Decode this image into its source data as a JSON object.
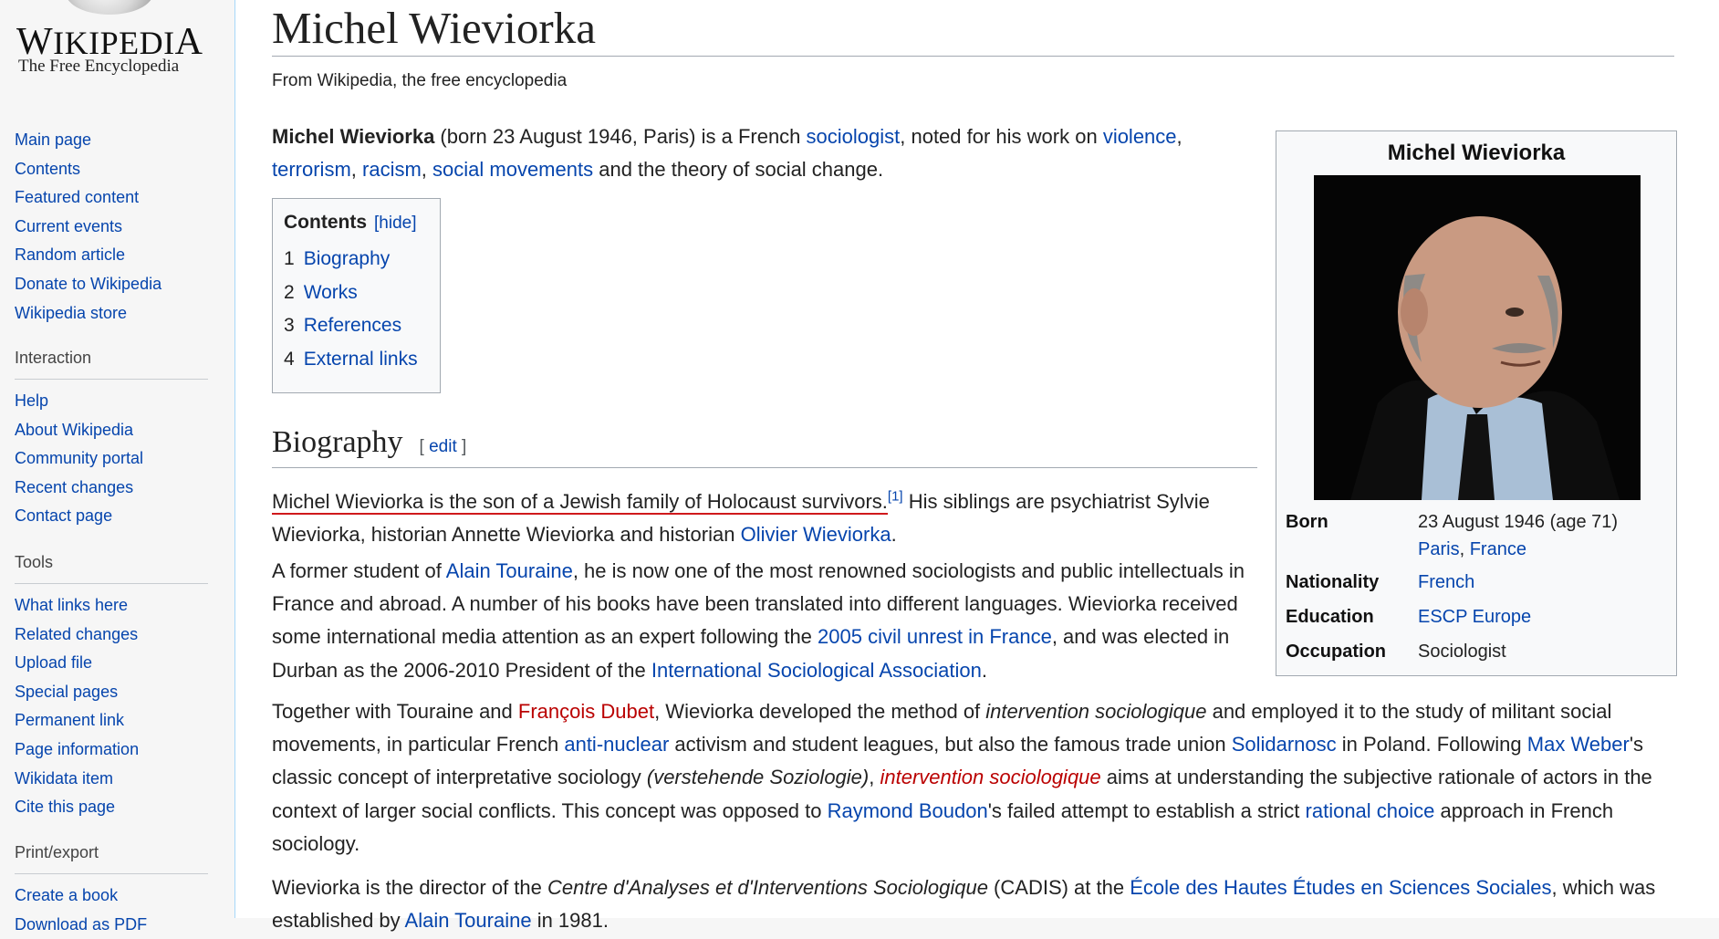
{
  "logo": {
    "wordmark": "Wikipedia",
    "tagline": "The Free Encyclopedia"
  },
  "sidebar": {
    "navigation": [
      "Main page",
      "Contents",
      "Featured content",
      "Current events",
      "Random article",
      "Donate to Wikipedia",
      "Wikipedia store"
    ],
    "interaction": {
      "heading": "Interaction",
      "items": [
        "Help",
        "About Wikipedia",
        "Community portal",
        "Recent changes",
        "Contact page"
      ]
    },
    "tools": {
      "heading": "Tools",
      "items": [
        "What links here",
        "Related changes",
        "Upload file",
        "Special pages",
        "Permanent link",
        "Page information",
        "Wikidata item",
        "Cite this page"
      ]
    },
    "print": {
      "heading": "Print/export",
      "items": [
        "Create a book",
        "Download as PDF"
      ]
    }
  },
  "article": {
    "title": "Michel Wieviorka",
    "site_sub": "From Wikipedia, the free encyclopedia",
    "lead": {
      "bold_name": "Michel Wieviorka",
      "t1": " (born 23 August 1946, Paris) is a French ",
      "link_sociologist": "sociologist",
      "t2": ", noted for his work on ",
      "link_violence": "violence",
      "t3": ", ",
      "link_terrorism": "terrorism",
      "t4": ", ",
      "link_racism": "racism",
      "t5": ", ",
      "link_social_movements": "social movements",
      "t6": " and the theory of social change."
    },
    "toc": {
      "title": "Contents",
      "toggle": "[hide]",
      "items": [
        {
          "num": "1",
          "label": "Biography"
        },
        {
          "num": "2",
          "label": "Works"
        },
        {
          "num": "3",
          "label": "References"
        },
        {
          "num": "4",
          "label": "External links"
        }
      ]
    },
    "biography": {
      "heading": "Biography",
      "edit": "edit",
      "edit_open": "[ ",
      "edit_close": " ]",
      "p1": {
        "underlined": "Michel Wieviorka is the son of a Jewish family of Holocaust survivors.",
        "ref": "[1]",
        "t1": " His siblings are psychiatrist Sylvie Wieviorka, historian Annette Wieviorka and historian ",
        "link_olivier": "Olivier Wieviorka",
        "t2": "."
      },
      "p2": {
        "t1": "A former student of ",
        "link_touraine": "Alain Touraine",
        "t2": ", he is now one of the most renowned sociologists and public intellectuals in France and abroad. A number of his books have been translated into different languages. Wieviorka received some international media attention as an expert following the ",
        "link_unrest": "2005 civil unrest in France",
        "t3": ", and was elected in Durban as the 2006-2010 President of the ",
        "link_isa": "International Sociological Association",
        "t4": "."
      },
      "p3": {
        "t1": "Together with Touraine and ",
        "link_dubet": "François Dubet",
        "t2": ", Wieviorka developed the method of ",
        "italic1": "intervention sociologique",
        "t3": " and employed it to the study of militant social movements, in particular French ",
        "link_antinuclear": "anti-nuclear",
        "t4": " activism and student leagues, but also the famous trade union ",
        "link_solidarnosc": "Solidarnosc",
        "t5": " in Poland. Following ",
        "link_weber": "Max Weber",
        "t6": "'s classic concept of interpretative sociology ",
        "italic2": "(verstehende Soziologie)",
        "t7": ", ",
        "link_intervention": "intervention sociologique",
        "t8": " aims at understanding the subjective rationale of actors in the context of larger social conflicts. This concept was opposed to ",
        "link_boudon": "Raymond Boudon",
        "t9": "'s failed attempt to establish a strict ",
        "link_rational": "rational choice",
        "t10": " approach in French sociology."
      },
      "p4": {
        "t1": "Wieviorka is the director of the ",
        "italic1": "Centre d'Analyses et d'Interventions Sociologique",
        "t2": " (CADIS) at the ",
        "link_ehess": "École des Hautes Études en Sciences Sociales",
        "t3": ", which was established by ",
        "link_touraine": "Alain Touraine",
        "t4": " in 1981."
      }
    }
  },
  "infobox": {
    "title": "Michel Wieviorka",
    "rows": {
      "born": {
        "label": "Born",
        "value1": "23 August 1946 (age 71)",
        "place_city": "Paris",
        "sep": ", ",
        "place_country": "France"
      },
      "nationality": {
        "label": "Nationality",
        "value": "French"
      },
      "education": {
        "label": "Education",
        "value": "ESCP Europe"
      },
      "occupation": {
        "label": "Occupation",
        "value": "Sociologist"
      }
    }
  }
}
